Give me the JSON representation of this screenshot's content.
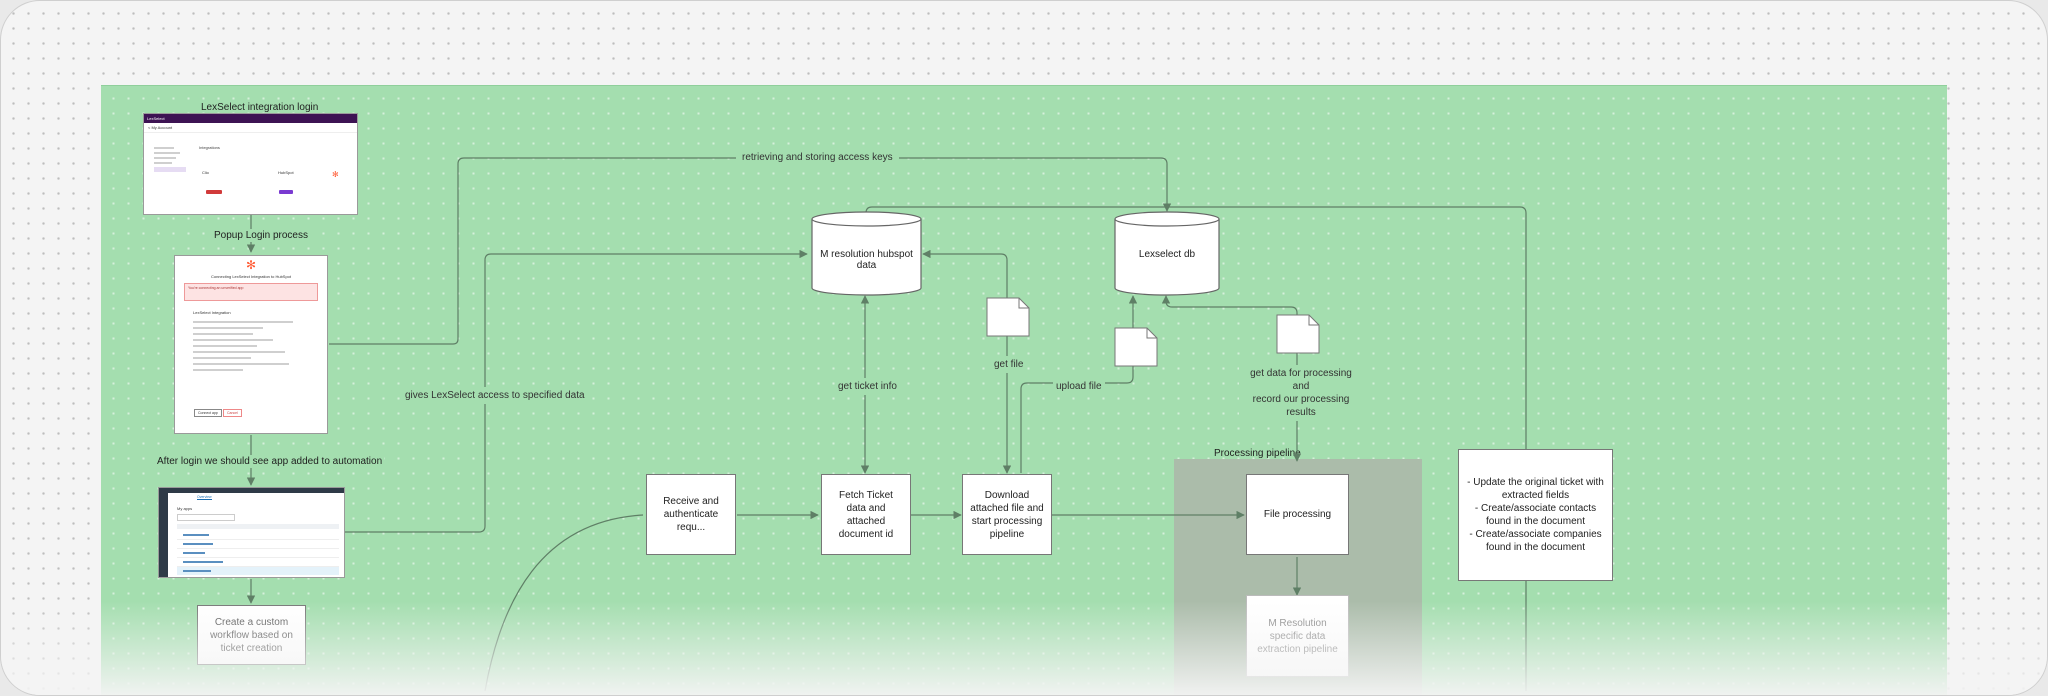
{
  "diagram": {
    "screens": {
      "login_screen": {
        "title": "LexSelect integration login",
        "app_name": "LexSelect",
        "back_link": "< My Account",
        "section_title": "Integrations",
        "card_left": "Clio",
        "card_right": "HubSpot",
        "colors": {
          "header": "#3d1353",
          "connect_left": "#d13a3a",
          "connect_right": "#7a3ad1",
          "hubspot_icon": "#ff5c35"
        }
      },
      "popup_screen": {
        "title": "Popup Login process",
        "heading": "Connecting LexSelect Integration to HubSpot",
        "warning": "You're connecting an unverified app",
        "subheading": "LexSelect Integration",
        "connect_button": "Connect app",
        "cancel_button": "Cancel"
      },
      "apps_screen": {
        "title": "After login we should see app added to automation",
        "tab_active": "Overview",
        "section_label": "My apps"
      }
    },
    "nodes": {
      "custom_workflow": "Create a custom workflow based on ticket creation",
      "receive_auth": "Receive and authenticate requ...",
      "fetch_ticket": "Fetch Ticket data and attached document id",
      "download_file": "Download attached file and start processing pipeline",
      "file_processing": "File processing",
      "m_resolution_pipeline": "M Resolution specific data extraction pipeline",
      "update_ticket": "- Update the original ticket with extracted fields\n- Create/associate contacts found in the document\n- Create/associate companies found in the document"
    },
    "databases": {
      "hubspot_data": "M resolution hubspot data",
      "lexselect_db": "Lexselect db"
    },
    "group": {
      "label": "Processing pipeline"
    },
    "edges": {
      "access_keys": "retrieving and storing access keys",
      "gives_access": "gives LexSelect access to specified data",
      "get_ticket_info": "get ticket info",
      "get_file": "get file",
      "upload_file": "upload file",
      "get_data_processing": "get data for processing and\nrecord our processing results"
    },
    "colors": {
      "board": "#a4deaf",
      "canvas": "#f4f4f4",
      "edge": "#5f7f66",
      "group": "#abbcaa"
    }
  }
}
